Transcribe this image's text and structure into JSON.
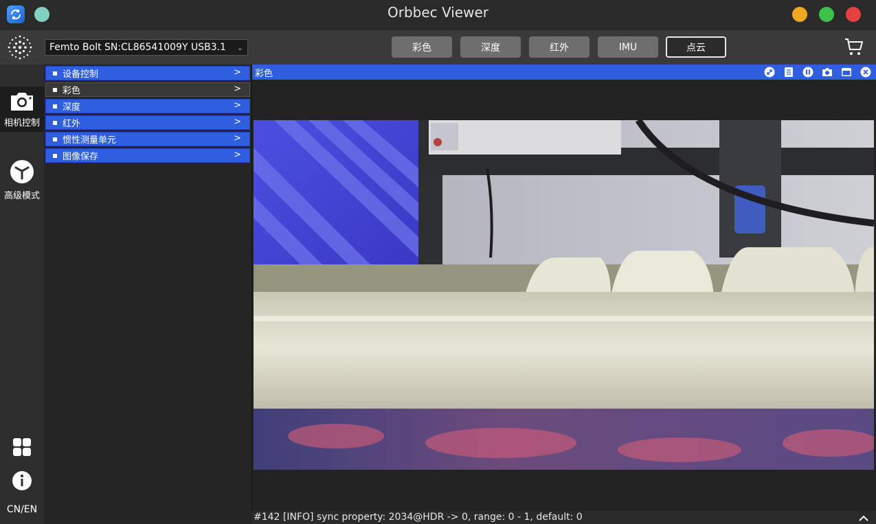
{
  "window": {
    "title": "Orbbec Viewer"
  },
  "toolbar": {
    "device": "Femto Bolt SN:CL86541009Y USB3.1",
    "tabs": [
      {
        "label": "彩色"
      },
      {
        "label": "深度"
      },
      {
        "label": "红外"
      },
      {
        "label": "IMU"
      },
      {
        "label": "点云",
        "active": true
      }
    ]
  },
  "rail": {
    "camera_label": "相机控制",
    "advanced_label": "高级模式",
    "lang_label": "CN/EN"
  },
  "menu": {
    "items": [
      {
        "label": "设备控制"
      },
      {
        "label": "彩色",
        "selected": true
      },
      {
        "label": "深度"
      },
      {
        "label": "红外"
      },
      {
        "label": "惯性测量单元"
      },
      {
        "label": "图像保存"
      }
    ],
    "arrow": ">"
  },
  "viewer": {
    "title": "彩色",
    "header_icons": [
      "expand-icon",
      "info-icon",
      "pause-icon",
      "camera-icon",
      "window-icon",
      "close-icon"
    ]
  },
  "log": {
    "text": "#142 [INFO] sync property: 2034@HDR -> 0, range: 0 - 1, default: 0"
  },
  "colors": {
    "accent": "#2f5fe0",
    "background": "#2f2f2f"
  }
}
